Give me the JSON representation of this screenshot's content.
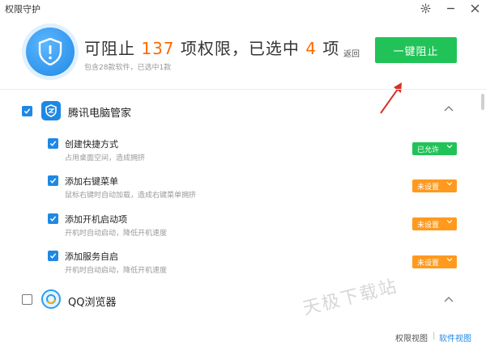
{
  "window": {
    "title": "权限守护"
  },
  "header": {
    "headline_prefix": "可阻止",
    "blockable_count": "137",
    "headline_middle": "项权限，已选中",
    "selected_count": "4",
    "headline_suffix": "项",
    "subline": "包含28款软件，已选中1款",
    "back_label": "返回",
    "block_button_label": "一键阻止"
  },
  "sections": [
    {
      "name": "腾讯电脑管家",
      "checked": true,
      "items": [
        {
          "title": "创建快捷方式",
          "desc": "占用桌面空间，造成拥挤",
          "status": "已允许",
          "status_type": "allowed"
        },
        {
          "title": "添加右键菜单",
          "desc": "鼠标右键时自动加载，造成右键菜单拥挤",
          "status": "未设置",
          "status_type": "unset"
        },
        {
          "title": "添加开机启动项",
          "desc": "开机时自动启动，降低开机速度",
          "status": "未设置",
          "status_type": "unset"
        },
        {
          "title": "添加服务自启",
          "desc": "开机时自动启动，降低开机速度",
          "status": "未设置",
          "status_type": "unset"
        }
      ]
    },
    {
      "name": "QQ浏览器",
      "checked": false,
      "items": []
    }
  ],
  "watermark": "天极下载站",
  "footer": {
    "permission_view": "权限视图",
    "software_view": "软件视图"
  },
  "colors": {
    "accent_blue": "#1e88e5",
    "green": "#21c358",
    "orange": "#ff9a1f",
    "count_orange": "#ff6a00",
    "arrow_red": "#d93025"
  },
  "icons": [
    "gear-icon",
    "minimize-icon",
    "close-icon",
    "shield-icon",
    "chevron-up-icon",
    "chevron-down-icon",
    "check-icon"
  ]
}
